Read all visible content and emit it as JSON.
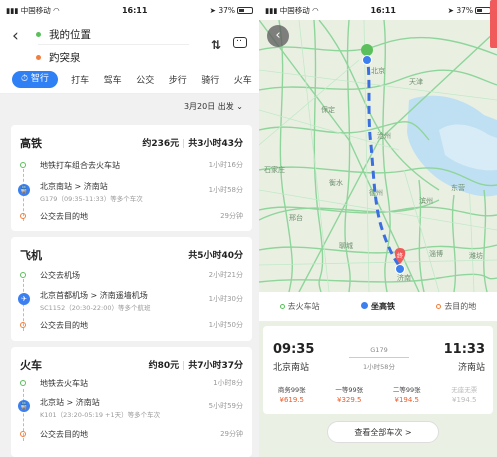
{
  "status_left": {
    "carrier": "中国移动",
    "time": "16:11",
    "battery": "37%"
  },
  "status_right": {
    "carrier": "中国移动",
    "time": "16:11",
    "battery": "37%"
  },
  "search": {
    "origin": "我的位置",
    "destination": "趵突泉"
  },
  "modes": [
    "智行",
    "打车",
    "驾车",
    "公交",
    "步行",
    "骑行",
    "火车"
  ],
  "date_text": "3月20日 出发",
  "cards": [
    {
      "title": "高铁",
      "price": "约236元",
      "duration": "共3小时43分",
      "steps": [
        {
          "label": "地铁打车组合去火车站",
          "sub": "",
          "time": "1小时16分"
        },
        {
          "label": "北京南站 > 济南站",
          "sub": "G179（09:35-11:33）等多个车次",
          "time": "1小时58分"
        },
        {
          "label": "公交去目的地",
          "sub": "",
          "time": "29分钟"
        }
      ]
    },
    {
      "title": "飞机",
      "price": "",
      "duration": "共5小时40分",
      "steps": [
        {
          "label": "公交去机场",
          "sub": "",
          "time": "2小时21分"
        },
        {
          "label": "北京首都机场 > 济南遥墙机场",
          "sub": "SC1152（20:30-22:00）等多个航班",
          "time": "1小时30分"
        },
        {
          "label": "公交去目的地",
          "sub": "",
          "time": "1小时50分"
        }
      ]
    },
    {
      "title": "火车",
      "price": "约80元",
      "duration": "共7小时37分",
      "steps": [
        {
          "label": "地铁去火车站",
          "sub": "",
          "time": "1小时8分"
        },
        {
          "label": "北京站 > 济南站",
          "sub": "K101（23:20-05:19 +1天）等多个车次",
          "time": "5小时59分"
        },
        {
          "label": "公交去目的地",
          "sub": "",
          "time": "29分钟"
        }
      ]
    }
  ],
  "map_labels": [
    "北京",
    "天津",
    "保定",
    "沧州",
    "德州",
    "石家庄",
    "衡水",
    "邢台",
    "聊城",
    "滨州",
    "东营",
    "淄博",
    "济南",
    "潍坊"
  ],
  "end_pin": "终",
  "legend": {
    "left": "去火车站",
    "mid": "坐高铁",
    "right": "去目的地"
  },
  "train": {
    "depart_time": "09:35",
    "depart_station": "北京南站",
    "arrive_time": "11:33",
    "arrive_station": "济南站",
    "number": "G179",
    "duration": "1小时58分",
    "seats": [
      {
        "name": "商务99张",
        "price": "¥619.5",
        "available": true
      },
      {
        "name": "一等99张",
        "price": "¥329.5",
        "available": true
      },
      {
        "name": "二等99张",
        "price": "¥194.5",
        "available": true
      },
      {
        "name": "无座无票",
        "price": "¥194.5",
        "available": false
      }
    ]
  },
  "view_all": "查看全部车次 >",
  "colors": {
    "accent": "#2f7ff5",
    "price": "#f05a28",
    "route": "#3b6fe0",
    "roads": "#7fcf8f"
  }
}
